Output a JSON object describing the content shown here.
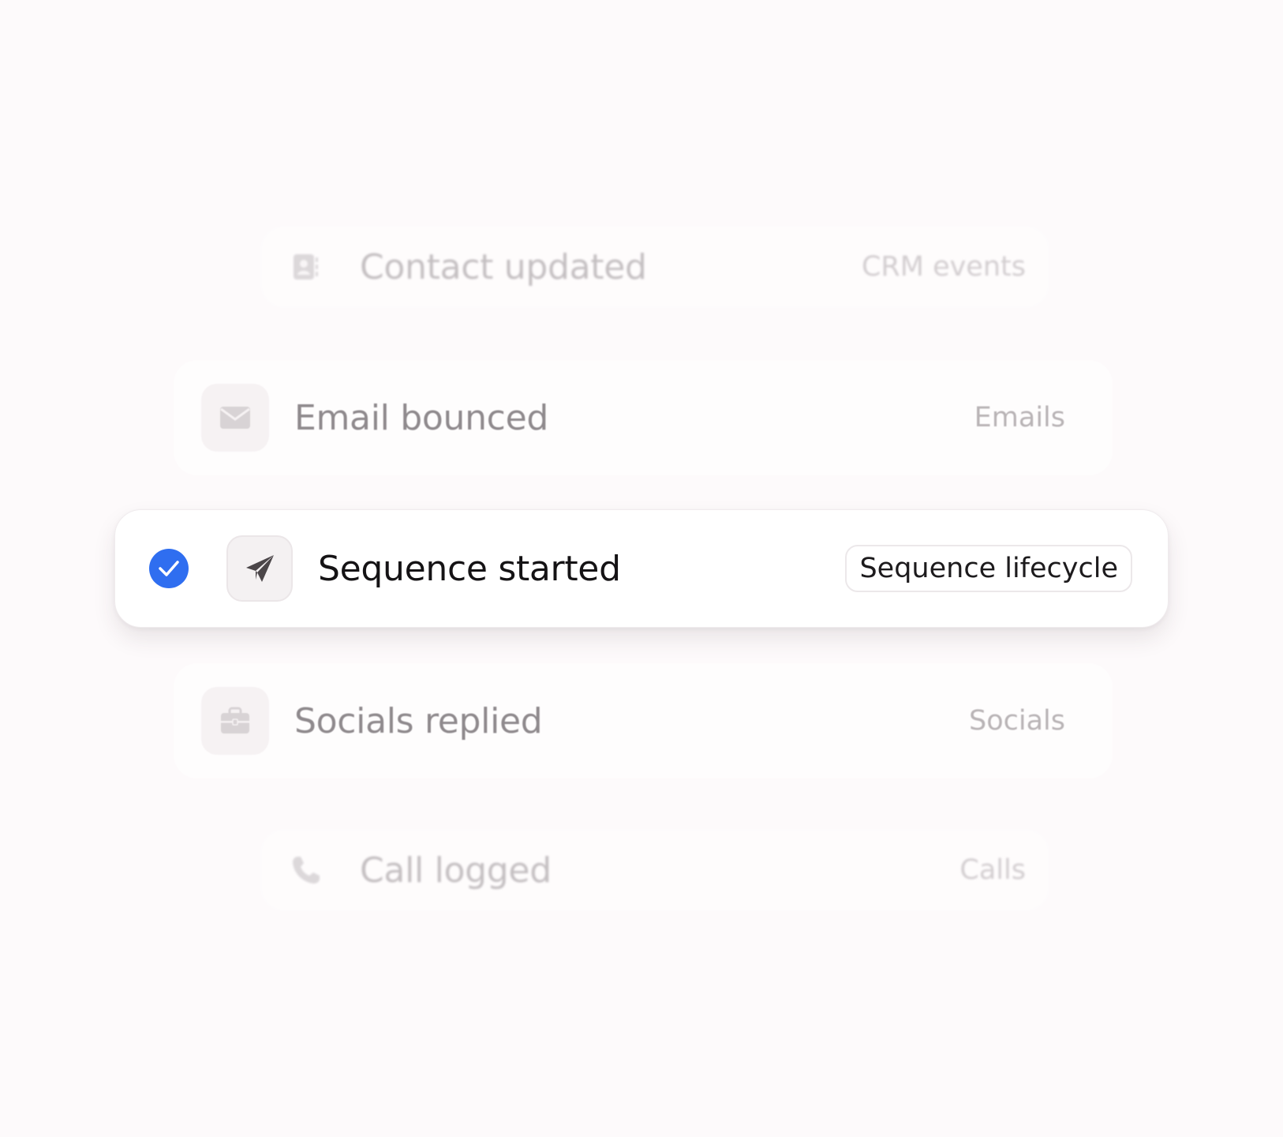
{
  "events": [
    {
      "label": "Contact updated",
      "category": "CRM events",
      "icon": "contact-card-icon",
      "selected": false
    },
    {
      "label": "Email bounced",
      "category": "Emails",
      "icon": "envelope-icon",
      "selected": false
    },
    {
      "label": "Sequence started",
      "category": "Sequence lifecycle",
      "icon": "paper-plane-icon",
      "selected": true
    },
    {
      "label": "Socials replied",
      "category": "Socials",
      "icon": "briefcase-icon",
      "selected": false
    },
    {
      "label": "Call logged",
      "category": "Calls",
      "icon": "phone-icon",
      "selected": false
    }
  ],
  "colors": {
    "accent": "#2f6ef0",
    "background": "#fdfafb"
  }
}
